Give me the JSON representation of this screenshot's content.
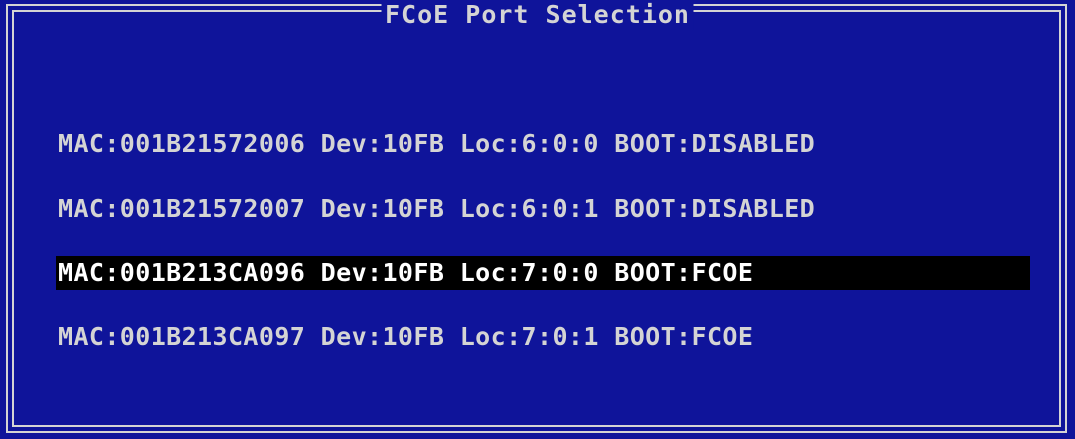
{
  "window": {
    "title": "FCoE Port Selection"
  },
  "ports": [
    {
      "label": "MAC:001B21572006 Dev:10FB Loc:6:0:0 BOOT:DISABLED",
      "selected": false
    },
    {
      "label": "MAC:001B21572007 Dev:10FB Loc:6:0:1 BOOT:DISABLED",
      "selected": false
    },
    {
      "label": "MAC:001B213CA096 Dev:10FB Loc:7:0:0 BOOT:FCOE",
      "selected": true
    },
    {
      "label": "MAC:001B213CA097 Dev:10FB Loc:7:0:1 BOOT:FCOE",
      "selected": false
    }
  ],
  "colors": {
    "background": "#0f149a",
    "text": "#d4d4d4",
    "highlight_bg": "#000000",
    "highlight_text": "#ffffff"
  }
}
